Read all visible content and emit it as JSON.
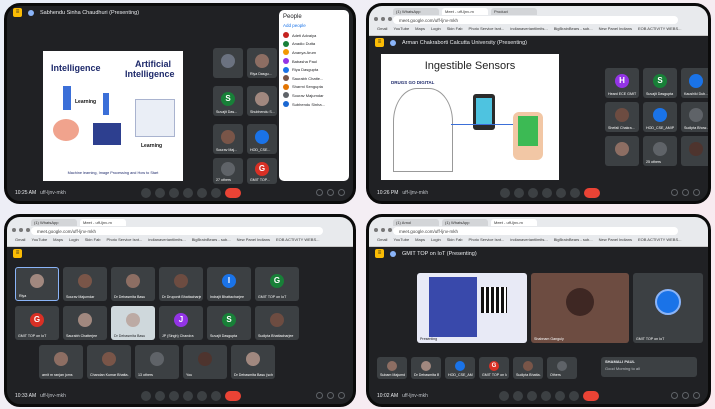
{
  "panel1": {
    "presenting": "Sabhendu Sinha Chaudhuri (Presenting)",
    "slide": {
      "left_title": "Intelligence",
      "right_title_1": "Artificial",
      "right_title_2": "Intelligence",
      "learning_left": "Learning",
      "learning_right": "Learning",
      "caption": "Machine learning, Image Processing and How to Start"
    },
    "tiles": [
      {
        "name": "",
        "initial": "",
        "color": "#6b7280"
      },
      {
        "name": "Riya Dasgu...",
        "initial": "",
        "color": "#8d6e63"
      },
      {
        "name": "Suvajit Das...",
        "initial": "S",
        "color": "#188038"
      },
      {
        "name": "Shubhendu S...",
        "initial": "",
        "color": "#a1887f"
      },
      {
        "name": "Sourav Maj...",
        "initial": "",
        "color": "#795548"
      },
      {
        "name": "HOD_CSE...",
        "initial": "",
        "color": "#1a73e8"
      },
      {
        "name": "27 others",
        "initial": "",
        "color": "#5f6368"
      },
      {
        "name": "GMIT TOP...",
        "initial": "G",
        "color": "#d93025"
      }
    ],
    "people_panel": {
      "title": "People",
      "add_label": "Add people",
      "rows": [
        {
          "name": "Adeti Advaiya",
          "color": "#c5221f"
        },
        {
          "name": "Anadio Dutta",
          "color": "#188038"
        },
        {
          "name": "Ananya Arum",
          "color": "#f29900"
        },
        {
          "name": "Babasha Paul",
          "color": "#9334e6"
        },
        {
          "name": "Riya Dasgupta",
          "color": "#1a73e8"
        },
        {
          "name": "Saurabh Chatte...",
          "color": "#795548"
        },
        {
          "name": "Sharmi Sengupta",
          "color": "#e37400"
        },
        {
          "name": "Sourav Majumdar",
          "color": "#5f6368"
        },
        {
          "name": "Subhendu Sinha...",
          "color": "#1967d2"
        }
      ]
    },
    "time": "10:25 AM",
    "code": "uff-ljnv-mkh"
  },
  "panel2": {
    "tabs": [
      "(1) WhatsApp",
      "Meet - uff-ljnv-m",
      "Product",
      "+"
    ],
    "address": "meet.google.com/uff-ljnv-mkh",
    "bookmarks": [
      "Gmail",
      "YouTube",
      "Maps",
      "Login",
      "Skin Fab",
      "Photo Service Isnt...",
      "indianaveriantlimits...",
      "BigBrainBears - sub...",
      "New Panel Indians",
      "EOB ACTIVITY WEBS..."
    ],
    "presenting": "Arman Chakraborti Calcutta University (Presenting)",
    "slide": {
      "title": "Ingestible Sensors",
      "subtitle": "DRUGS GO DIGITAL"
    },
    "tiles": [
      {
        "name": "Heard ECE GMIT",
        "initial": "H",
        "color": "#9334e6"
      },
      {
        "name": "Suvajit Dasgupta",
        "initial": "S",
        "color": "#188038"
      },
      {
        "name": "Kaushiki Dub...",
        "initial": "",
        "color": "#1a73e8"
      },
      {
        "name": "Shefali Chakra...",
        "initial": "",
        "color": "#6d4c41"
      },
      {
        "name": "HOD_CSE_AMIP",
        "initial": "",
        "color": "#1a73e8"
      },
      {
        "name": "Sudipta Bhow...",
        "initial": "",
        "color": "#5f6368"
      },
      {
        "name": "",
        "initial": "",
        "color": "#8d6e63"
      },
      {
        "name": "25 others",
        "initial": "",
        "color": "#5f6368"
      },
      {
        "name": "",
        "initial": "",
        "color": "#4e342e"
      }
    ],
    "time": "10:26 PM",
    "code": "uff-ljnv-mkh"
  },
  "panel3": {
    "tabs": [
      "(1) WhatsApp",
      "Meet - uff-ljnv-m",
      "+"
    ],
    "address": "meet.google.com/uff-ljnv-mkh",
    "bookmarks": [
      "Gmail",
      "YouTube",
      "Maps",
      "Login",
      "Skin Fab",
      "Photo Service Isnt...",
      "indianaveriantlimits...",
      "BigBrainBears - sub...",
      "New Panel Indians",
      "EOB ACTIVITY WEBS..."
    ],
    "tiles": [
      {
        "name": "Riya",
        "initial": "",
        "color": "#a1887f"
      },
      {
        "name": "Sourav Majumdar",
        "initial": "",
        "color": "#795548"
      },
      {
        "name": "Dr Debasmita Basu",
        "initial": "",
        "color": "#8d6e63"
      },
      {
        "name": "Dr Druponit Bhattacharjee",
        "initial": "",
        "color": "#6d4c41"
      },
      {
        "name": "Indrajit Bhattacharjee",
        "initial": "I",
        "color": "#1a73e8"
      },
      {
        "name": "GMIT TOP on IoT",
        "initial": "G",
        "color": "#188038"
      },
      {
        "name": "GMIT TOP on IoT",
        "initial": "G",
        "color": "#d93025"
      },
      {
        "name": "Saurabh Chatterjee",
        "initial": "",
        "color": "#a1887f"
      },
      {
        "name": "Dr Debasmita Basu",
        "initial": "",
        "color": "#bcaaa4"
      },
      {
        "name": "JP (Singh) Chandra",
        "initial": "J",
        "color": "#9334e6"
      },
      {
        "name": "Suvajit Dasgupta",
        "initial": "S",
        "color": "#188038"
      },
      {
        "name": "Sudipta Bhattacharjee",
        "initial": "",
        "color": "#6d4c41"
      },
      {
        "name": "arnit m ranjan joms",
        "initial": "",
        "color": "#8d6e63"
      },
      {
        "name": "Chandan Kumar Bhatta...",
        "initial": "",
        "color": "#795548"
      },
      {
        "name": "13 others",
        "initial": "",
        "color": "#5f6368"
      },
      {
        "name": "You",
        "initial": "",
        "color": "#4e342e"
      },
      {
        "name": "Dr Debasmita Basu (school)",
        "initial": "",
        "color": "#a1887f"
      }
    ],
    "time": "10:33 AM",
    "code": "uff-ljnv-mkh"
  },
  "panel4": {
    "tabs": [
      "(1) Arnol",
      "(1) WhatsApp",
      "Meet - uff-ljnv-m",
      "+"
    ],
    "address": "meet.google.com/uff-ljnv-mkh",
    "bookmarks": [
      "Gmail",
      "YouTube",
      "Maps",
      "Login",
      "Skin Fab",
      "Photo Service Isnt...",
      "indianaveriantlimits...",
      "BigBrainBears - sub...",
      "New Panel Indians",
      "EOB ACTIVITY WEBS..."
    ],
    "presenting": "GMIT TOP on IoT (Presenting)",
    "main_speaker": "Shabnam Ganguly",
    "presenter_tile_label": "Presenting",
    "pinned_label": "GMIT TOP on IoT",
    "tiles": [
      {
        "name": "Subam Majumder",
        "initial": "",
        "color": "#8d6e63"
      },
      {
        "name": "Dr Debasmita Ba...",
        "initial": "",
        "color": "#a1887f"
      },
      {
        "name": "HOD_CSE_AMIP",
        "initial": "",
        "color": "#1a73e8"
      },
      {
        "name": "GMIT TOP on IoT",
        "initial": "G",
        "color": "#d93025"
      },
      {
        "name": "Sudipta Bhatta...",
        "initial": "",
        "color": "#795548"
      },
      {
        "name": "Others",
        "initial": "",
        "color": "#5f6368"
      }
    ],
    "chat": {
      "sender": "SHAMALI PAUL",
      "message": "Good Morning to all"
    },
    "time": "10:02 AM",
    "code": "uff-ljnv-mkh"
  }
}
